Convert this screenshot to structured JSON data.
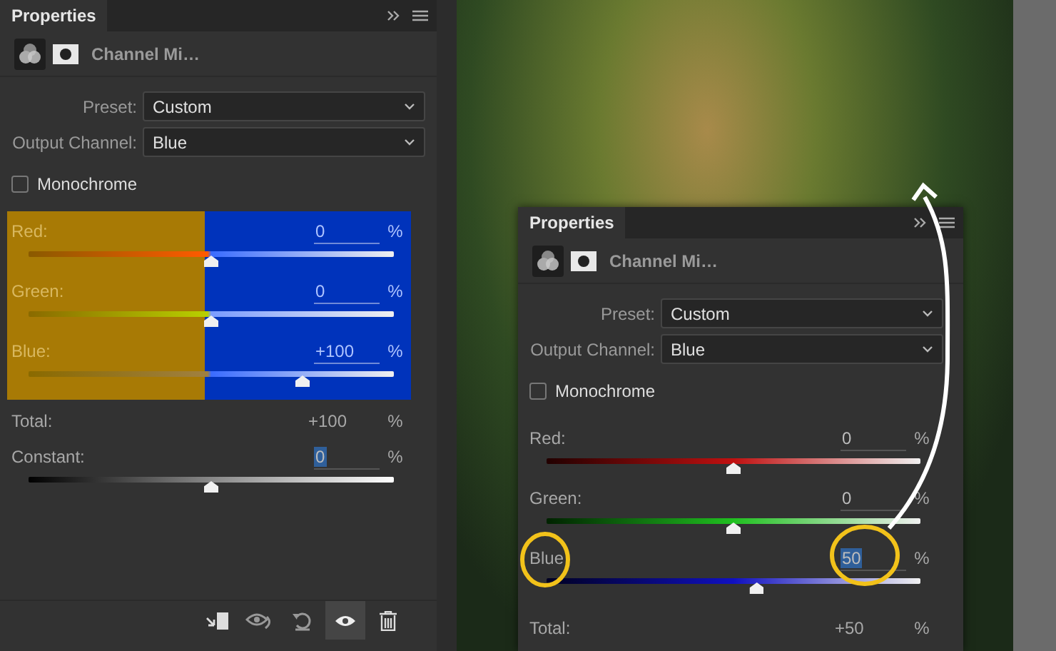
{
  "panels": [
    {
      "tab": "Properties",
      "title": "Channel Mi…",
      "preset_label": "Preset:",
      "preset": "Custom",
      "output_label": "Output Channel:",
      "output": "Blue",
      "monochrome": {
        "label": "Monochrome",
        "checked": false
      },
      "channels_highlighted": true,
      "channels": [
        {
          "kind": "red",
          "name": "Red:",
          "value": "0",
          "unit": "%",
          "level": 0.5,
          "value_selected": false
        },
        {
          "kind": "green",
          "name": "Green:",
          "value": "0",
          "unit": "%",
          "level": 0.5,
          "value_selected": false
        },
        {
          "kind": "blue",
          "name": "Blue:",
          "value": "+100",
          "unit": "%",
          "level": 0.75,
          "value_selected": false
        }
      ],
      "total": {
        "label": "Total:",
        "value": "+100",
        "unit": "%"
      },
      "constant": {
        "name": "Constant:",
        "value": "0",
        "unit": "%",
        "level": 0.5,
        "value_selected": true
      },
      "toolbar": [
        {
          "kind": "clip",
          "on": false
        },
        {
          "kind": "view-previous",
          "on": false
        },
        {
          "kind": "reset",
          "on": false
        },
        {
          "kind": "visibility",
          "on": true
        },
        {
          "kind": "delete",
          "on": false
        }
      ]
    },
    {
      "tab": "Properties",
      "title": "Channel Mi…",
      "preset_label": "Preset:",
      "preset": "Custom",
      "output_label": "Output Channel:",
      "output": "Blue",
      "monochrome": {
        "label": "Monochrome",
        "checked": false
      },
      "channels_highlighted": false,
      "channels": [
        {
          "kind": "red",
          "name": "Red:",
          "value": "0",
          "unit": "%",
          "level": 0.5,
          "value_selected": false
        },
        {
          "kind": "green",
          "name": "Green:",
          "value": "0",
          "unit": "%",
          "level": 0.5,
          "value_selected": false
        },
        {
          "kind": "blue",
          "name": "Blue",
          "value": "50",
          "unit": "%",
          "level": 0.5625,
          "value_selected": true
        }
      ],
      "total": {
        "label": "Total:",
        "value": "+50",
        "unit": "%"
      }
    }
  ]
}
